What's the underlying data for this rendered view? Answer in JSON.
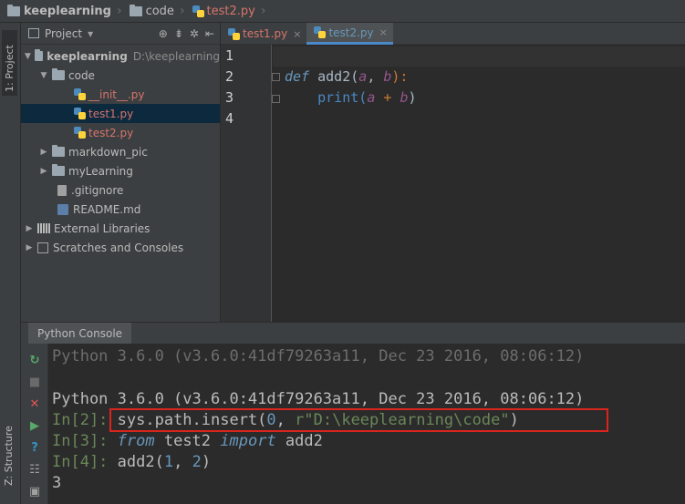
{
  "breadcrumb": {
    "project": "keeplearning",
    "folder": "code",
    "file": "test2.py"
  },
  "sidebar": {
    "tab_project": "1: Project",
    "tab_structure": "Z: Structure"
  },
  "project_panel": {
    "header_label": "Project",
    "header_dropdown": "▾",
    "items": [
      {
        "label": "keeplearning",
        "path": "D:\\keeplearning"
      },
      {
        "label": "code"
      },
      {
        "label": "__init__.py"
      },
      {
        "label": "test1.py"
      },
      {
        "label": "test2.py"
      },
      {
        "label": "markdown_pic"
      },
      {
        "label": "myLearning"
      },
      {
        "label": ".gitignore"
      },
      {
        "label": "README.md"
      },
      {
        "label": "External Libraries"
      },
      {
        "label": "Scratches and Consoles"
      }
    ]
  },
  "editor": {
    "tabs": [
      {
        "label": "test1.py",
        "close": "×"
      },
      {
        "label": "test2.py",
        "close": "×"
      }
    ],
    "line_numbers": [
      "1",
      "2",
      "3",
      "4"
    ],
    "code": {
      "l2_def": "def",
      "l2_name": " add2(",
      "l2_a": "a",
      "l2_comma": ", ",
      "l2_b": "b",
      "l2_close": "):",
      "l3_print": "    print(",
      "l3_a": "a",
      "l3_plus": " + ",
      "l3_b": "b",
      "l3_close": ")"
    }
  },
  "console": {
    "tab_label": "Python Console",
    "faded_line": "Python 3.6.0 (v3.6.0:41df79263a11, Dec 23 2016, 08:06:12)",
    "version_line": "Python 3.6.0 (v3.6.0:41df79263a11, Dec 23 2016, 08:06:12)",
    "p2": "In[2]:",
    "c2_a": " sys.path.insert(",
    "c2_num": "0",
    "c2_b": ", ",
    "c2_str": "r\"D:\\keeplearning\\code\"",
    "c2_c": ")",
    "p3": "In[3]:",
    "c3_from": " from",
    "c3_mod": " test2 ",
    "c3_import": "import",
    "c3_name": " add2",
    "p4": "In[4]:",
    "c4_a": " add2(",
    "c4_n1": "1",
    "c4_b": ", ",
    "c4_n2": "2",
    "c4_c": ")",
    "output": "3"
  }
}
